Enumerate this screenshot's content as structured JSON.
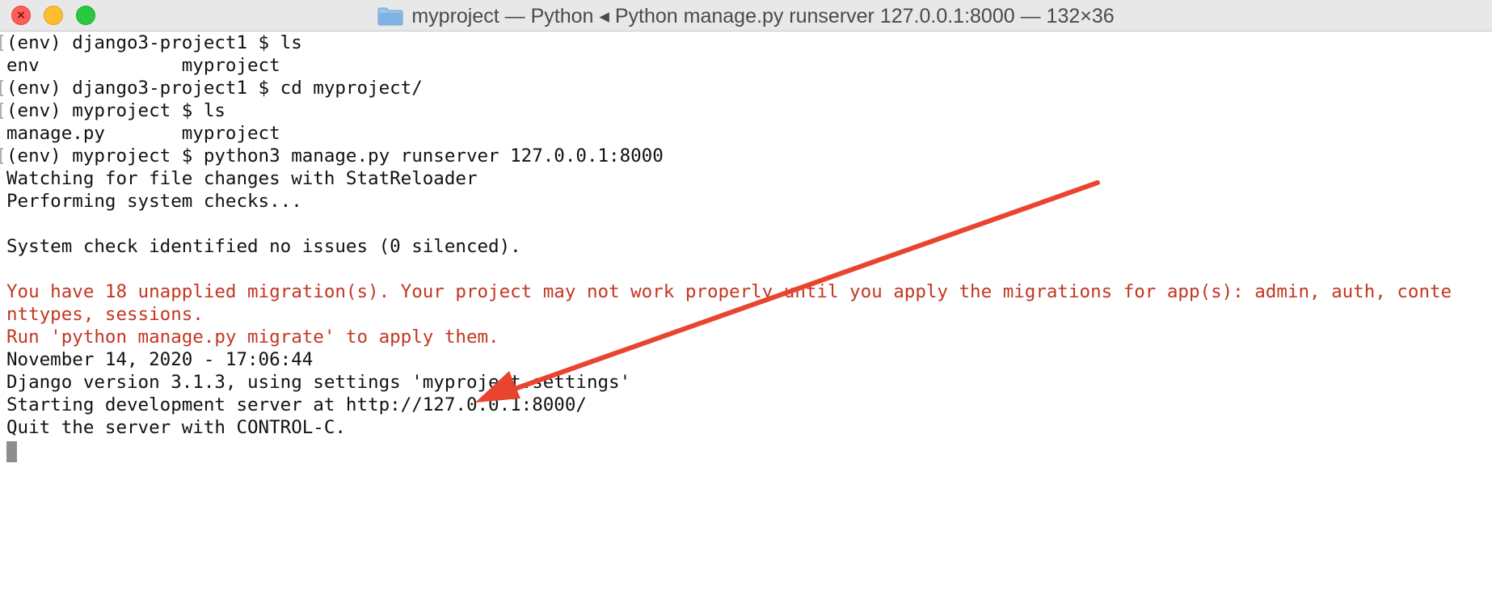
{
  "window": {
    "title": "myproject — Python ◂ Python manage.py runserver 127.0.0.1:8000 — 132×36",
    "folder_icon": "folder-icon",
    "buttons": {
      "close": "close-button",
      "minimize": "minimize-button",
      "zoom": "zoom-button"
    },
    "close_glyph": "×"
  },
  "terminal": {
    "lines": [
      {
        "text": "(env) django3-project1 $ ls",
        "prompt": true,
        "color": "normal"
      },
      {
        "text": "env             myproject",
        "prompt": false,
        "color": "normal"
      },
      {
        "text": "(env) django3-project1 $ cd myproject/",
        "prompt": true,
        "color": "normal"
      },
      {
        "text": "(env) myproject $ ls",
        "prompt": true,
        "color": "normal"
      },
      {
        "text": "manage.py       myproject",
        "prompt": false,
        "color": "normal"
      },
      {
        "text": "(env) myproject $ python3 manage.py runserver 127.0.0.1:8000",
        "prompt": true,
        "color": "normal"
      },
      {
        "text": "Watching for file changes with StatReloader",
        "prompt": false,
        "color": "normal"
      },
      {
        "text": "Performing system checks...",
        "prompt": false,
        "color": "normal"
      },
      {
        "text": "",
        "prompt": false,
        "color": "normal"
      },
      {
        "text": "System check identified no issues (0 silenced).",
        "prompt": false,
        "color": "normal"
      },
      {
        "text": "",
        "prompt": false,
        "color": "normal"
      },
      {
        "text": "You have 18 unapplied migration(s). Your project may not work properly until you apply the migrations for app(s): admin, auth, conte",
        "prompt": false,
        "color": "red"
      },
      {
        "text": "nttypes, sessions.",
        "prompt": false,
        "color": "red"
      },
      {
        "text": "Run 'python manage.py migrate' to apply them.",
        "prompt": false,
        "color": "red"
      },
      {
        "text": "November 14, 2020 - 17:06:44",
        "prompt": false,
        "color": "normal"
      },
      {
        "text": "Django version 3.1.3, using settings 'myproject.settings'",
        "prompt": false,
        "color": "normal"
      },
      {
        "text": "Starting development server at http://127.0.0.1:8000/",
        "prompt": false,
        "color": "normal"
      },
      {
        "text": "Quit the server with CONTROL-C.",
        "prompt": false,
        "color": "normal"
      }
    ],
    "cursor": "block-cursor"
  },
  "colors": {
    "titlebar_bg": "#e9e8e9",
    "text": "#111111",
    "error_text": "#c23621",
    "annotation_arrow": "#e8442e",
    "folder": "#7fb2e5"
  },
  "annotation": {
    "icon": "red-arrow-annotation"
  }
}
